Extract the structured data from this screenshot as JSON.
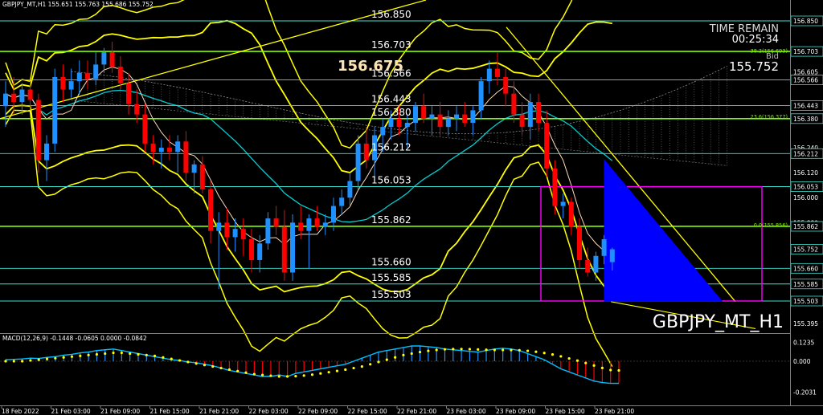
{
  "window": {
    "header": "GBPJPY_MT,H1  155.651 155.763 155.686 155.752",
    "symbol_label": "GBPJPY_MT_H1",
    "time_remain_label": "TIME REMAIN",
    "time_remain_value": "00:25:34",
    "bid_label": "Bid",
    "bid_value": "155.752",
    "big_price": "156.675",
    "macd_header": "MACD(12,26,9) -0.1448 -0.0605 0.0000 -0.0842"
  },
  "colors": {
    "background": "#000000",
    "bull_candle": "#1E90FF",
    "bear_candle": "#FF0000",
    "bollinger": "#FFFF00",
    "level_line": "#40E0D0",
    "key_level": "#7CFC00",
    "box": "#FF00FF",
    "triangle": "#0000FF",
    "macd_signal": "#00BFFF",
    "macd_dots": "#FFFF00"
  },
  "chart_data": {
    "type": "candlestick",
    "symbol": "GBPJPY_MT",
    "timeframe": "H1",
    "ylim": [
      155.34,
      156.97
    ],
    "price_axis_ticks": [
      {
        "label": "156.850",
        "value": 156.85,
        "highlight": true
      },
      {
        "label": "156.703",
        "value": 156.703,
        "highlight": true
      },
      {
        "label": "156.605",
        "value": 156.605,
        "highlight": false
      },
      {
        "label": "156.566",
        "value": 156.566,
        "highlight": true
      },
      {
        "label": "156.443",
        "value": 156.443,
        "highlight": true
      },
      {
        "label": "156.380",
        "value": 156.38,
        "highlight": true
      },
      {
        "label": "156.240",
        "value": 156.24,
        "highlight": false
      },
      {
        "label": "156.212",
        "value": 156.212,
        "highlight": true
      },
      {
        "label": "156.120",
        "value": 156.12,
        "highlight": false
      },
      {
        "label": "156.053",
        "value": 156.053,
        "highlight": true
      },
      {
        "label": "156.000",
        "value": 156.0,
        "highlight": false
      },
      {
        "label": "155.880",
        "value": 155.88,
        "highlight": false
      },
      {
        "label": "155.862",
        "value": 155.862,
        "highlight": true
      },
      {
        "label": "155.752",
        "value": 155.752,
        "highlight": true
      },
      {
        "label": "155.660",
        "value": 155.66,
        "highlight": true
      },
      {
        "label": "155.585",
        "value": 155.585,
        "highlight": true
      },
      {
        "label": "155.503",
        "value": 155.503,
        "highlight": true
      },
      {
        "label": "155.395",
        "value": 155.395,
        "highlight": false
      }
    ],
    "level_lines": [
      {
        "label": "156.850",
        "value": 156.85,
        "kind": "level"
      },
      {
        "label": "156.703",
        "value": 156.703,
        "kind": "key"
      },
      {
        "label": "156.566",
        "value": 156.566,
        "kind": "level"
      },
      {
        "label": "156.443",
        "value": 156.443,
        "kind": "level"
      },
      {
        "label": "156.380",
        "value": 156.38,
        "kind": "key"
      },
      {
        "label": "156.212",
        "value": 156.212,
        "kind": "level"
      },
      {
        "label": "156.053",
        "value": 156.053,
        "kind": "level"
      },
      {
        "label": "155.862",
        "value": 155.862,
        "kind": "key"
      },
      {
        "label": "155.660",
        "value": 155.66,
        "kind": "level"
      },
      {
        "label": "155.585",
        "value": 155.585,
        "kind": "level"
      },
      {
        "label": "155.503",
        "value": 155.503,
        "kind": "level"
      }
    ],
    "fib_labels": [
      {
        "label": "38.2(156.693)",
        "value": 156.693
      },
      {
        "label": "23.6(156.377)",
        "value": 156.377
      },
      {
        "label": "0.0(155.856)",
        "value": 155.856
      }
    ],
    "time_labels": [
      "18 Feb 2022",
      "21 Feb 03:00",
      "21 Feb 09:00",
      "21 Feb 15:00",
      "21 Feb 21:00",
      "22 Feb 03:00",
      "22 Feb 09:00",
      "22 Feb 15:00",
      "22 Feb 21:00",
      "23 Feb 03:00",
      "23 Feb 09:00",
      "23 Feb 15:00",
      "23 Feb 21:00"
    ],
    "candles": [
      {
        "o": 156.44,
        "h": 156.56,
        "l": 156.34,
        "c": 156.5
      },
      {
        "o": 156.5,
        "h": 156.58,
        "l": 156.4,
        "c": 156.46
      },
      {
        "o": 156.46,
        "h": 156.55,
        "l": 156.4,
        "c": 156.52
      },
      {
        "o": 156.52,
        "h": 156.56,
        "l": 156.42,
        "c": 156.47
      },
      {
        "o": 156.47,
        "h": 156.5,
        "l": 156.12,
        "c": 156.18
      },
      {
        "o": 156.18,
        "h": 156.3,
        "l": 156.08,
        "c": 156.26
      },
      {
        "o": 156.26,
        "h": 156.62,
        "l": 156.22,
        "c": 156.58
      },
      {
        "o": 156.58,
        "h": 156.64,
        "l": 156.46,
        "c": 156.52
      },
      {
        "o": 156.52,
        "h": 156.62,
        "l": 156.48,
        "c": 156.56
      },
      {
        "o": 156.56,
        "h": 156.66,
        "l": 156.5,
        "c": 156.6
      },
      {
        "o": 156.6,
        "h": 156.66,
        "l": 156.52,
        "c": 156.57
      },
      {
        "o": 156.57,
        "h": 156.7,
        "l": 156.54,
        "c": 156.64
      },
      {
        "o": 156.64,
        "h": 156.72,
        "l": 156.6,
        "c": 156.7
      },
      {
        "o": 156.7,
        "h": 156.75,
        "l": 156.6,
        "c": 156.63
      },
      {
        "o": 156.63,
        "h": 156.68,
        "l": 156.52,
        "c": 156.55
      },
      {
        "o": 156.55,
        "h": 156.6,
        "l": 156.4,
        "c": 156.45
      },
      {
        "o": 156.45,
        "h": 156.52,
        "l": 156.36,
        "c": 156.4
      },
      {
        "o": 156.4,
        "h": 156.45,
        "l": 156.22,
        "c": 156.26
      },
      {
        "o": 156.26,
        "h": 156.3,
        "l": 156.16,
        "c": 156.22
      },
      {
        "o": 156.22,
        "h": 156.28,
        "l": 156.14,
        "c": 156.24
      },
      {
        "o": 156.24,
        "h": 156.3,
        "l": 156.18,
        "c": 156.22
      },
      {
        "o": 156.22,
        "h": 156.3,
        "l": 156.12,
        "c": 156.27
      },
      {
        "o": 156.27,
        "h": 156.32,
        "l": 156.08,
        "c": 156.12
      },
      {
        "o": 156.12,
        "h": 156.18,
        "l": 156.02,
        "c": 156.16
      },
      {
        "o": 156.16,
        "h": 156.2,
        "l": 156.02,
        "c": 156.04
      },
      {
        "o": 156.04,
        "h": 156.08,
        "l": 155.78,
        "c": 155.84
      },
      {
        "o": 155.84,
        "h": 155.93,
        "l": 155.56,
        "c": 155.88
      },
      {
        "o": 155.88,
        "h": 155.95,
        "l": 155.75,
        "c": 155.81
      },
      {
        "o": 155.81,
        "h": 155.9,
        "l": 155.74,
        "c": 155.85
      },
      {
        "o": 155.85,
        "h": 155.9,
        "l": 155.72,
        "c": 155.8
      },
      {
        "o": 155.8,
        "h": 155.85,
        "l": 155.64,
        "c": 155.7
      },
      {
        "o": 155.7,
        "h": 155.82,
        "l": 155.64,
        "c": 155.78
      },
      {
        "o": 155.78,
        "h": 155.93,
        "l": 155.75,
        "c": 155.9
      },
      {
        "o": 155.9,
        "h": 155.96,
        "l": 155.82,
        "c": 155.86
      },
      {
        "o": 155.86,
        "h": 155.94,
        "l": 155.6,
        "c": 155.64
      },
      {
        "o": 155.64,
        "h": 155.92,
        "l": 155.6,
        "c": 155.88
      },
      {
        "o": 155.88,
        "h": 155.96,
        "l": 155.8,
        "c": 155.84
      },
      {
        "o": 155.84,
        "h": 155.92,
        "l": 155.66,
        "c": 155.9
      },
      {
        "o": 155.9,
        "h": 155.96,
        "l": 155.84,
        "c": 155.86
      },
      {
        "o": 155.86,
        "h": 155.92,
        "l": 155.82,
        "c": 155.88
      },
      {
        "o": 155.88,
        "h": 156.0,
        "l": 155.84,
        "c": 155.96
      },
      {
        "o": 155.96,
        "h": 156.04,
        "l": 155.92,
        "c": 156.0
      },
      {
        "o": 156.0,
        "h": 156.12,
        "l": 155.96,
        "c": 156.08
      },
      {
        "o": 156.08,
        "h": 156.3,
        "l": 156.04,
        "c": 156.26
      },
      {
        "o": 156.26,
        "h": 156.34,
        "l": 156.14,
        "c": 156.18
      },
      {
        "o": 156.18,
        "h": 156.34,
        "l": 156.1,
        "c": 156.3
      },
      {
        "o": 156.3,
        "h": 156.38,
        "l": 156.22,
        "c": 156.34
      },
      {
        "o": 156.34,
        "h": 156.42,
        "l": 156.28,
        "c": 156.38
      },
      {
        "o": 156.38,
        "h": 156.44,
        "l": 156.3,
        "c": 156.34
      },
      {
        "o": 156.34,
        "h": 156.4,
        "l": 156.24,
        "c": 156.36
      },
      {
        "o": 156.36,
        "h": 156.46,
        "l": 156.32,
        "c": 156.44
      },
      {
        "o": 156.44,
        "h": 156.5,
        "l": 156.36,
        "c": 156.38
      },
      {
        "o": 156.38,
        "h": 156.44,
        "l": 156.3,
        "c": 156.4
      },
      {
        "o": 156.4,
        "h": 156.46,
        "l": 156.3,
        "c": 156.34
      },
      {
        "o": 156.34,
        "h": 156.42,
        "l": 156.3,
        "c": 156.38
      },
      {
        "o": 156.38,
        "h": 156.44,
        "l": 156.32,
        "c": 156.4
      },
      {
        "o": 156.4,
        "h": 156.46,
        "l": 156.34,
        "c": 156.36
      },
      {
        "o": 156.36,
        "h": 156.44,
        "l": 156.3,
        "c": 156.42
      },
      {
        "o": 156.42,
        "h": 156.58,
        "l": 156.38,
        "c": 156.56
      },
      {
        "o": 156.56,
        "h": 156.66,
        "l": 156.5,
        "c": 156.62
      },
      {
        "o": 156.62,
        "h": 156.7,
        "l": 156.54,
        "c": 156.58
      },
      {
        "o": 156.58,
        "h": 156.62,
        "l": 156.44,
        "c": 156.5
      },
      {
        "o": 156.5,
        "h": 156.56,
        "l": 156.36,
        "c": 156.4
      },
      {
        "o": 156.4,
        "h": 156.46,
        "l": 156.3,
        "c": 156.34
      },
      {
        "o": 156.34,
        "h": 156.5,
        "l": 156.28,
        "c": 156.46
      },
      {
        "o": 156.46,
        "h": 156.5,
        "l": 156.32,
        "c": 156.36
      },
      {
        "o": 156.36,
        "h": 156.42,
        "l": 156.1,
        "c": 156.14
      },
      {
        "o": 156.14,
        "h": 156.18,
        "l": 155.92,
        "c": 155.96
      },
      {
        "o": 155.96,
        "h": 156.02,
        "l": 155.9,
        "c": 155.98
      },
      {
        "o": 155.98,
        "h": 156.0,
        "l": 155.82,
        "c": 155.86
      },
      {
        "o": 155.86,
        "h": 155.9,
        "l": 155.66,
        "c": 155.7
      },
      {
        "o": 155.7,
        "h": 155.76,
        "l": 155.62,
        "c": 155.64
      },
      {
        "o": 155.64,
        "h": 155.74,
        "l": 155.6,
        "c": 155.72
      },
      {
        "o": 155.72,
        "h": 155.82,
        "l": 155.68,
        "c": 155.8
      },
      {
        "o": 155.69,
        "h": 155.76,
        "l": 155.65,
        "c": 155.752
      }
    ],
    "macd": {
      "histogram": [
        0.01,
        0.012,
        0.015,
        0.02,
        0.018,
        0.025,
        0.03,
        0.04,
        0.045,
        0.055,
        0.06,
        0.07,
        0.075,
        0.08,
        0.07,
        0.06,
        0.05,
        0.04,
        0.03,
        0.02,
        0.01,
        0.005,
        -0.005,
        -0.01,
        -0.02,
        -0.03,
        -0.045,
        -0.06,
        -0.07,
        -0.08,
        -0.09,
        -0.1,
        -0.1,
        -0.09,
        -0.1,
        -0.08,
        -0.07,
        -0.06,
        -0.05,
        -0.04,
        -0.03,
        -0.02,
        0.0,
        0.02,
        0.04,
        0.06,
        0.07,
        0.08,
        0.09,
        0.1,
        0.1,
        0.095,
        0.09,
        0.08,
        0.075,
        0.07,
        0.065,
        0.06,
        0.07,
        0.08,
        0.085,
        0.08,
        0.07,
        0.05,
        0.03,
        0.01,
        -0.02,
        -0.05,
        -0.07,
        -0.09,
        -0.11,
        -0.13,
        -0.14,
        -0.145,
        -0.1448
      ],
      "signal": [
        0.0,
        0.0,
        0.0,
        0.005,
        0.01,
        0.015,
        0.02,
        0.025,
        0.03,
        0.035,
        0.04,
        0.045,
        0.05,
        0.055,
        0.055,
        0.05,
        0.045,
        0.04,
        0.035,
        0.025,
        0.015,
        0.005,
        -0.005,
        -0.015,
        -0.025,
        -0.035,
        -0.045,
        -0.055,
        -0.065,
        -0.075,
        -0.085,
        -0.09,
        -0.095,
        -0.1,
        -0.1,
        -0.098,
        -0.094,
        -0.088,
        -0.08,
        -0.072,
        -0.064,
        -0.055,
        -0.045,
        -0.035,
        -0.02,
        -0.005,
        0.01,
        0.025,
        0.04,
        0.05,
        0.06,
        0.068,
        0.074,
        0.078,
        0.08,
        0.08,
        0.079,
        0.077,
        0.075,
        0.074,
        0.074,
        0.073,
        0.072,
        0.068,
        0.062,
        0.054,
        0.044,
        0.032,
        0.018,
        0.004,
        -0.012,
        -0.028,
        -0.044,
        -0.058,
        -0.0605
      ]
    }
  }
}
